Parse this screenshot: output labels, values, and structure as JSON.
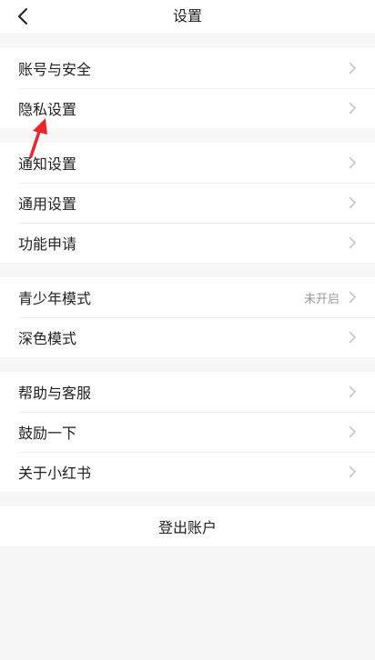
{
  "header": {
    "title": "设置",
    "back_icon": "chevron-left-icon"
  },
  "groups": [
    {
      "items": [
        {
          "label": "账号与安全"
        },
        {
          "label": "隐私设置"
        }
      ]
    },
    {
      "items": [
        {
          "label": "通知设置"
        },
        {
          "label": "通用设置"
        },
        {
          "label": "功能申请"
        }
      ]
    },
    {
      "items": [
        {
          "label": "青少年模式",
          "value": "未开启"
        },
        {
          "label": "深色模式"
        }
      ]
    },
    {
      "items": [
        {
          "label": "帮助与客服"
        },
        {
          "label": "鼓励一下"
        },
        {
          "label": "关于小红书"
        }
      ]
    }
  ],
  "logout": {
    "label": "登出账户"
  },
  "colors": {
    "background": "#f7f7f7",
    "surface": "#ffffff",
    "annotation": "#e8262b",
    "chevron": "#c4c4c4"
  }
}
